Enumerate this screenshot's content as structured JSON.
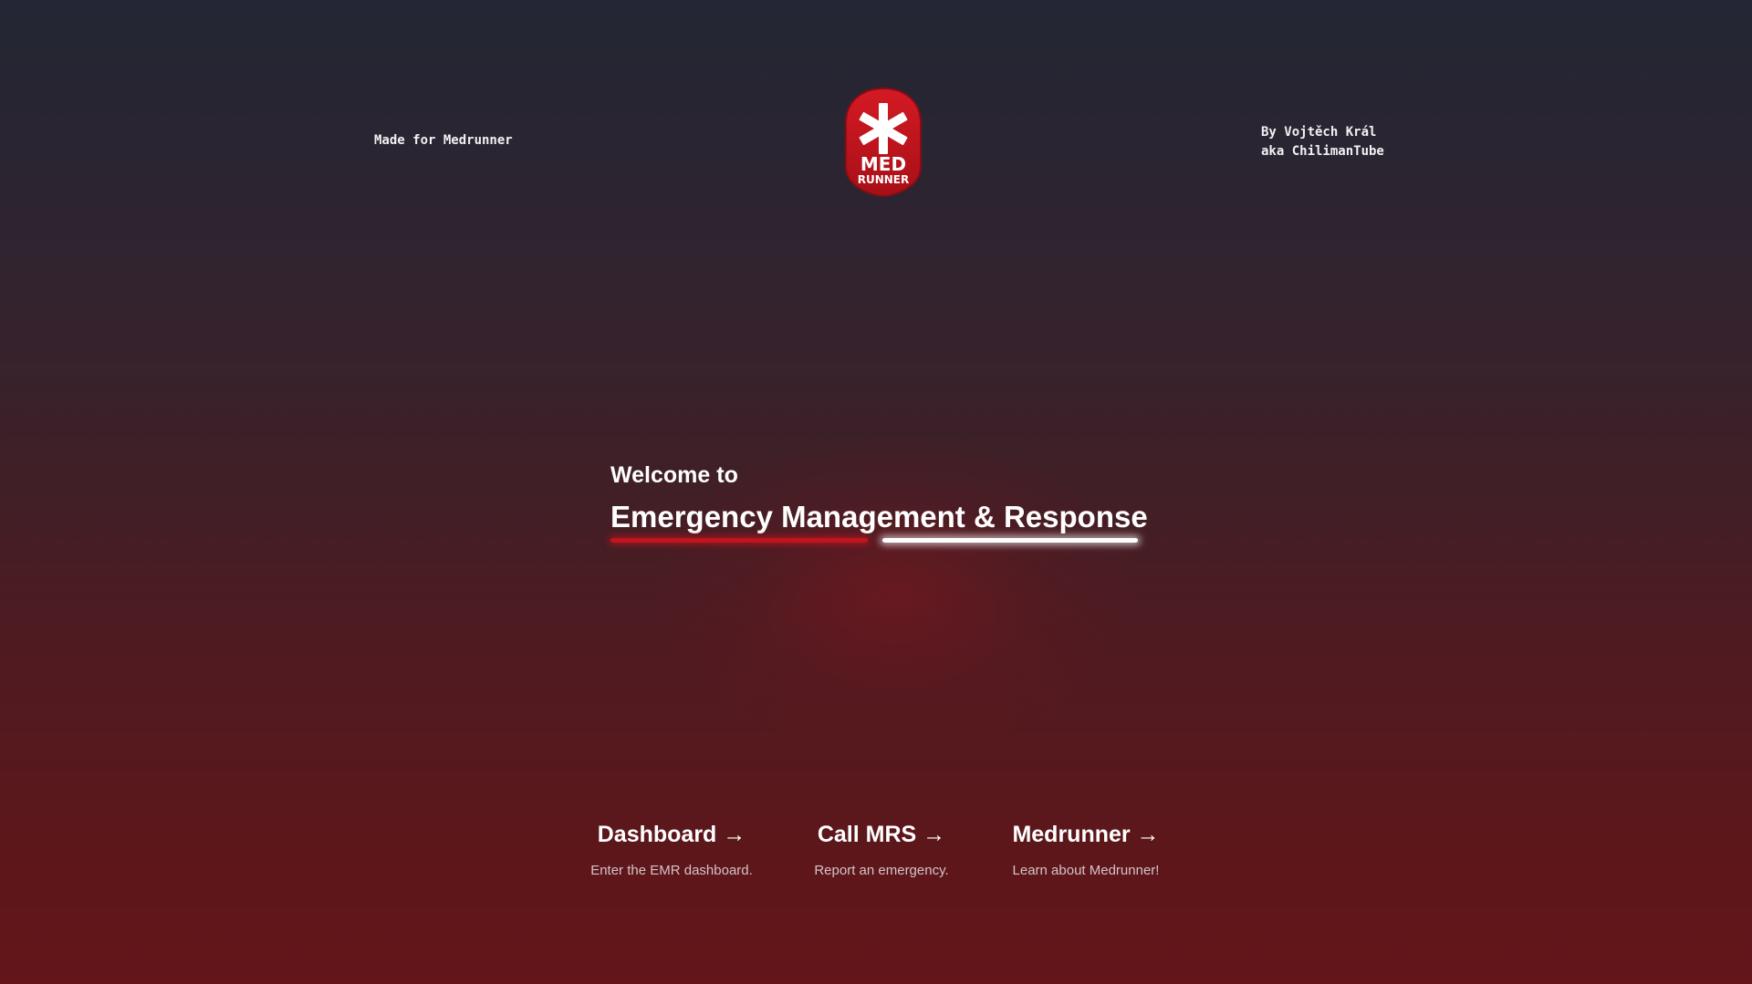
{
  "header": {
    "made_for": "Made for Medrunner",
    "author_line1": "By Vojtěch Král",
    "author_line2": "aka ChilimanTube",
    "logo": {
      "icon": "medrunner-logo",
      "text_top": "MED",
      "text_bottom": "RUNNER",
      "color": "#c8161f"
    }
  },
  "hero": {
    "welcome": "Welcome to",
    "headline": "Emergency Management & Response"
  },
  "nav": [
    {
      "title": "Dashboard →",
      "description": "Enter the EMR dashboard."
    },
    {
      "title": "Call MRS →",
      "description": "Report an emergency."
    },
    {
      "title": "Medrunner →",
      "description": "Learn about Medrunner!"
    }
  ],
  "colors": {
    "accent_red": "#c0141e",
    "background_top": "#232634",
    "background_bottom": "#63151a"
  }
}
